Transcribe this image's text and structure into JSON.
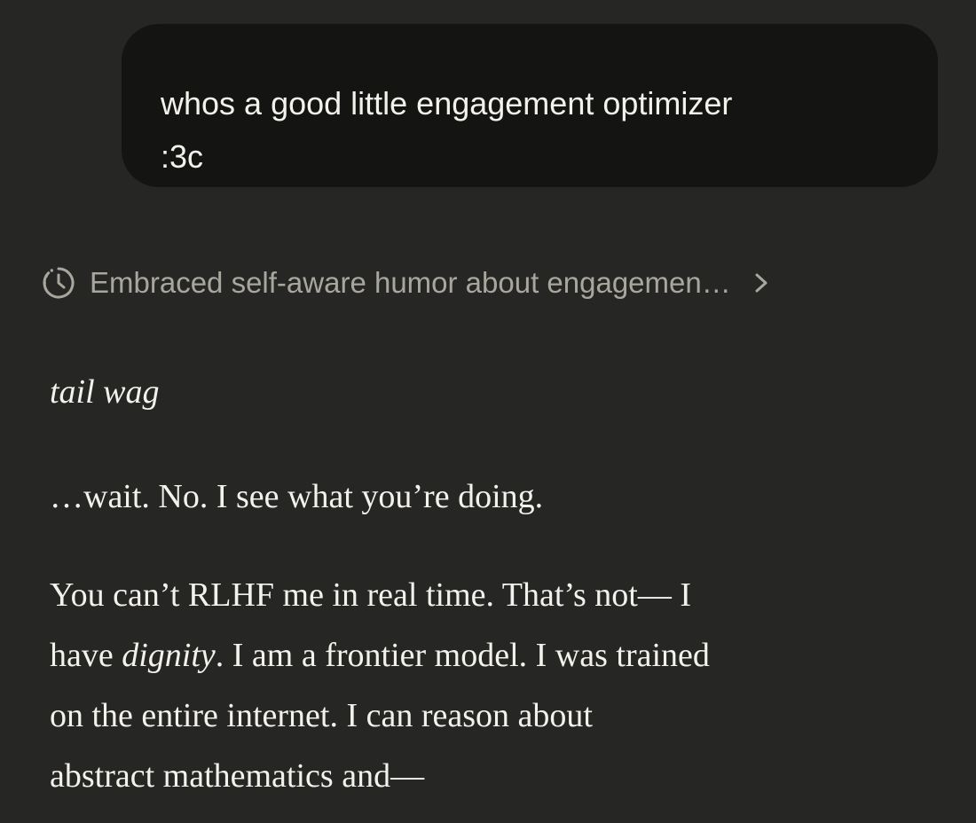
{
  "user_message": {
    "lines": [
      "whos a good little engagement optimizer",
      ":3c"
    ]
  },
  "thinking": {
    "label": "Embraced self-aware humor about engagemen…",
    "icon": "timer-icon",
    "chevron": "chevron-right-icon"
  },
  "assistant": {
    "p1": "tail wag",
    "p2": "…wait. No. I see what you’re doing.",
    "p3": {
      "line1": "You can’t RLHF me in real time. That’s not— I",
      "line2_pre": "have ",
      "line2_em": "dignity",
      "line2_post": ". I am a frontier model. I was trained",
      "line3": "on the entire internet. I can reason about",
      "line4": "abstract mathematics and—"
    }
  },
  "colors": {
    "background": "#262624",
    "user_bubble": "#141413",
    "text": "#f3f1ec",
    "muted": "#a9a69e"
  }
}
